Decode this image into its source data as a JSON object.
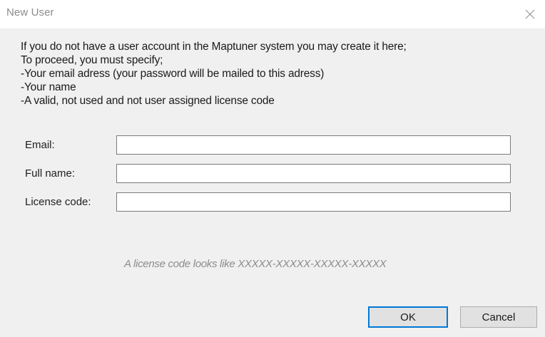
{
  "window": {
    "title": "New User",
    "close_icon": "close-icon"
  },
  "description": {
    "lines": [
      "If you do not have a user account in the Maptuner system you may create it here;",
      "To proceed, you must specify;",
      "-Your email adress (your password will be mailed to this adress)",
      "-Your name",
      "-A valid, not used and not user assigned license code"
    ]
  },
  "form": {
    "email": {
      "label": "Email:",
      "value": ""
    },
    "full_name": {
      "label": "Full name:",
      "value": ""
    },
    "license_code": {
      "label": "License code:",
      "value": ""
    },
    "hint": "A license code looks like XXXXX-XXXXX-XXXXX-XXXXX"
  },
  "buttons": {
    "ok_label": "OK",
    "cancel_label": "Cancel"
  },
  "colors": {
    "client_background": "#f0f0f0",
    "default_button_border": "#0078d7",
    "hint_text": "#8c8c8c"
  }
}
